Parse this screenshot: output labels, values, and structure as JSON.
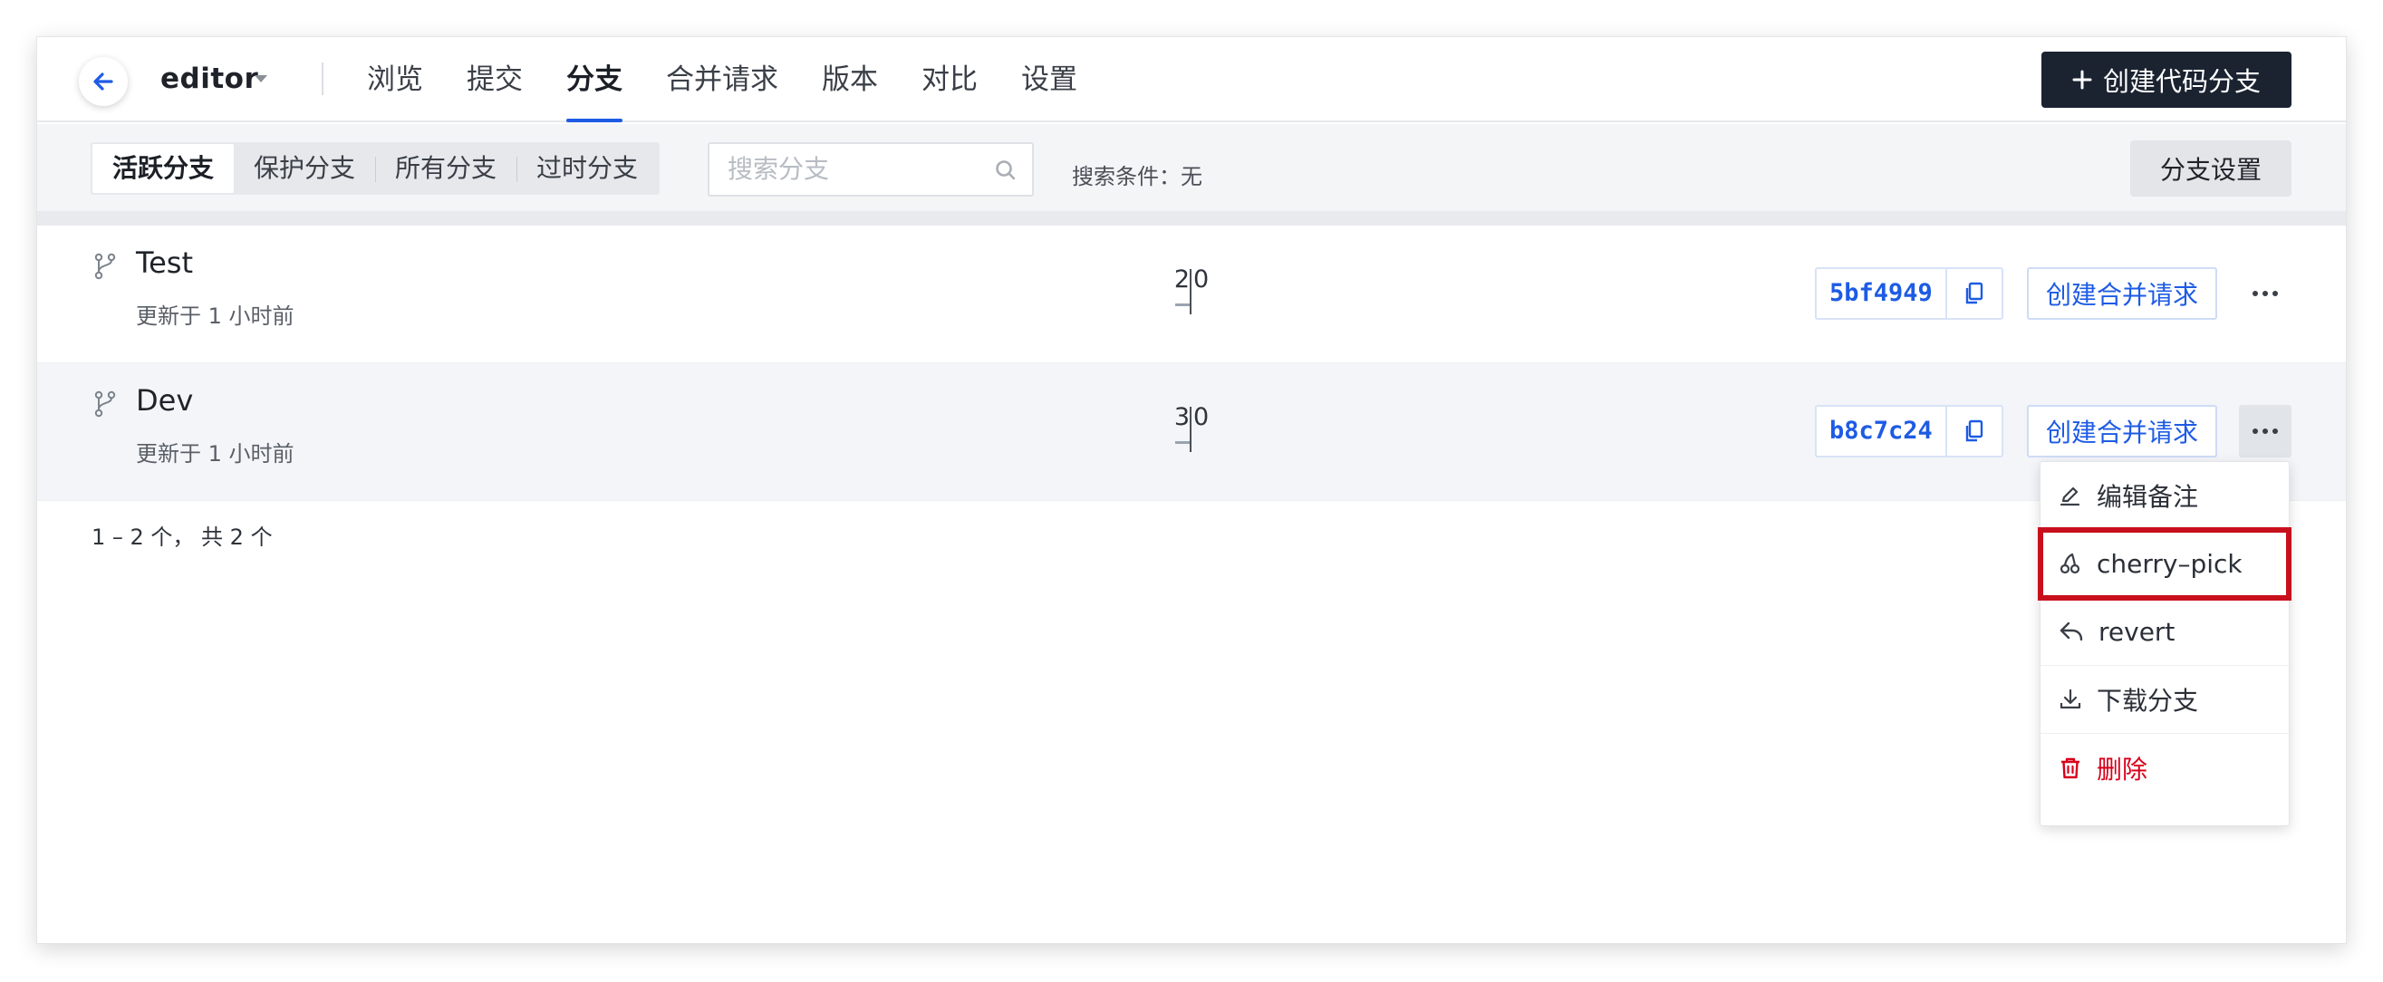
{
  "header": {
    "repo_name": "editor",
    "nav": [
      "浏览",
      "提交",
      "分支",
      "合并请求",
      "版本",
      "对比",
      "设置"
    ],
    "active_nav": "分支",
    "create_button": "创建代码分支"
  },
  "filter": {
    "tabs": [
      "活跃分支",
      "保护分支",
      "所有分支",
      "过时分支"
    ],
    "active_tab": "活跃分支",
    "search_placeholder": "搜索分支",
    "search_condition": "搜索条件：无",
    "settings_button": "分支设置"
  },
  "branches": [
    {
      "name": "Test",
      "updated": "更新于 1 小时前",
      "ahead": "2",
      "behind": "0",
      "sha": "5bf4949",
      "mr_label": "创建合并请求"
    },
    {
      "name": "Dev",
      "updated": "更新于 1 小时前",
      "ahead": "3",
      "behind": "0",
      "sha": "b8c7c24",
      "mr_label": "创建合并请求"
    }
  ],
  "pagination": "1 – 2 个， 共 2 个",
  "menu": {
    "items": [
      {
        "label": "编辑备注",
        "icon": "edit-icon"
      },
      {
        "label": "cherry–pick",
        "icon": "cherry-pick-icon"
      },
      {
        "label": "revert",
        "icon": "revert-icon"
      },
      {
        "label": "下载分支",
        "icon": "download-icon"
      },
      {
        "label": "删除",
        "icon": "trash-icon"
      }
    ],
    "highlighted": "cherry–pick"
  },
  "colors": {
    "primary": "#1d5be4",
    "dark_button": "#1b2230",
    "danger": "#d9001b",
    "highlight_border": "#c8101c"
  }
}
